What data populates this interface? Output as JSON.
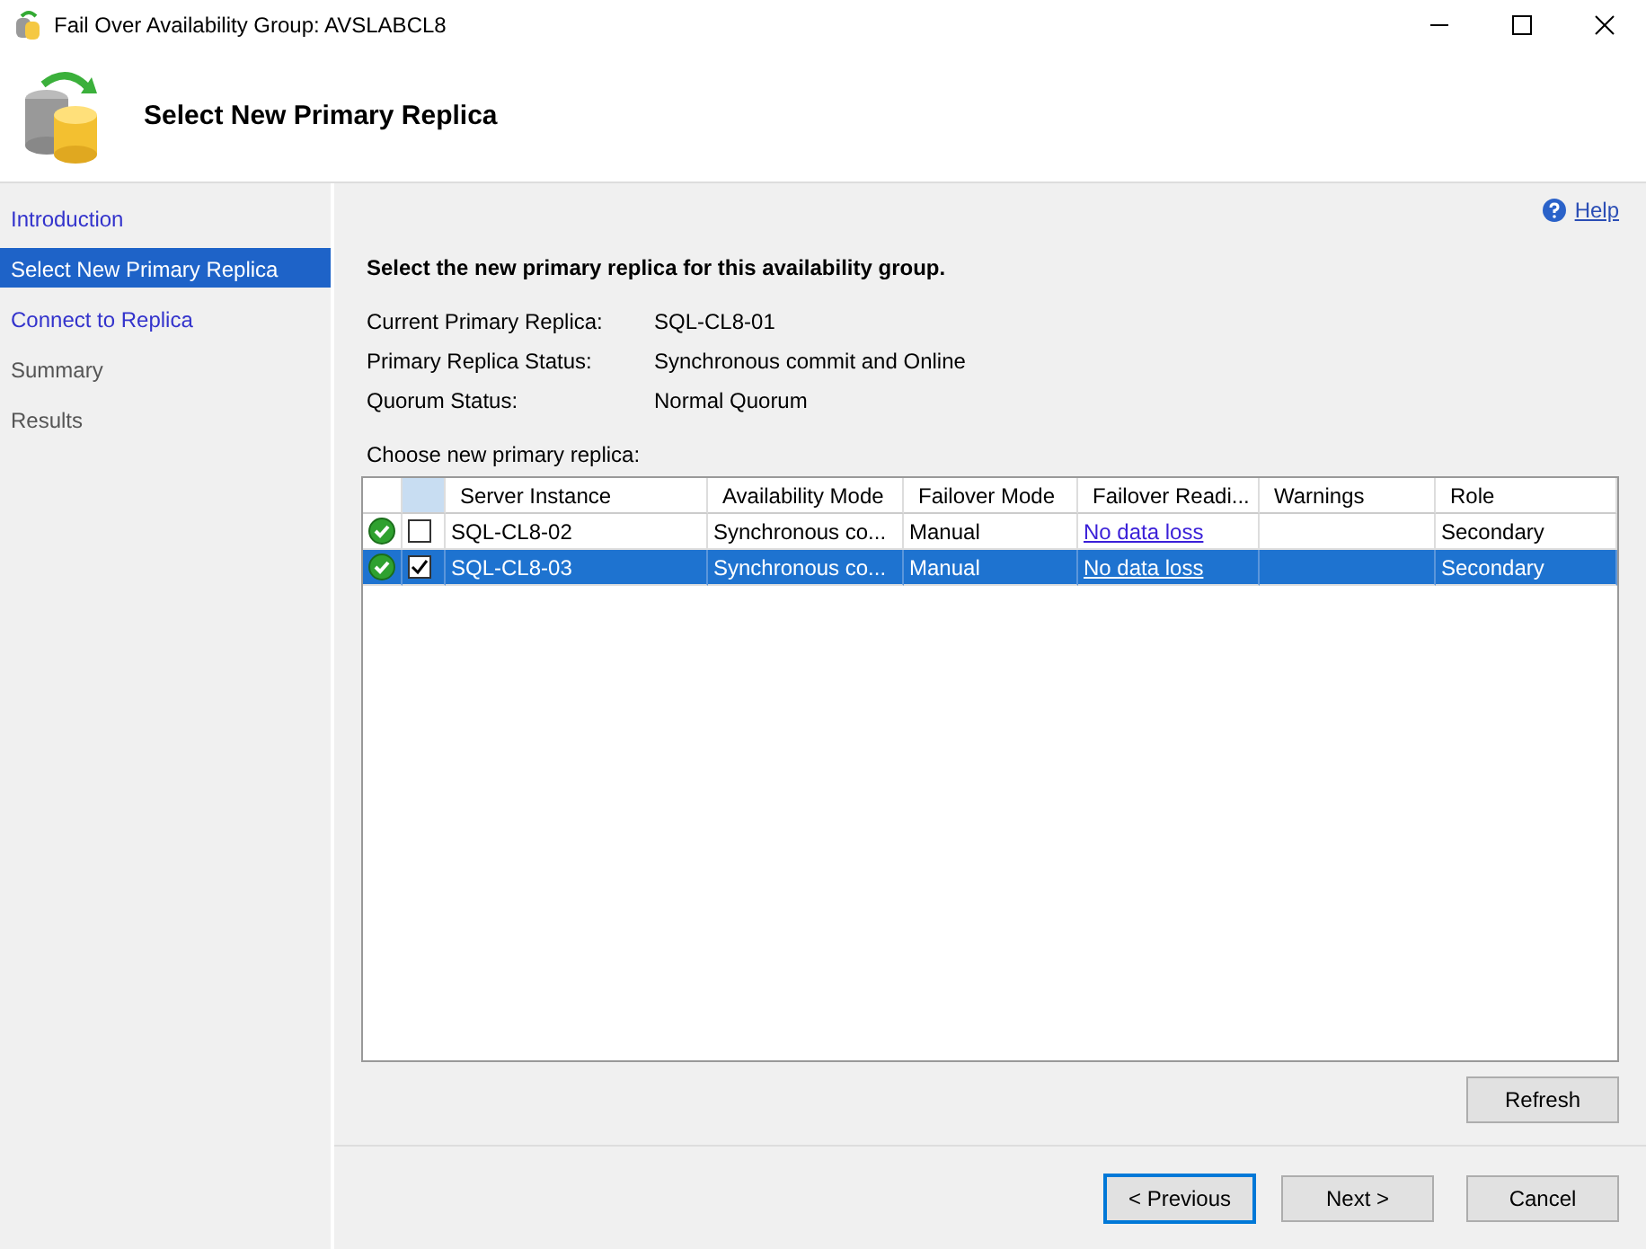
{
  "window": {
    "title": "Fail Over Availability Group: AVSLABCL8"
  },
  "header": {
    "title": "Select New Primary Replica"
  },
  "sidebar": {
    "items": [
      {
        "label": "Introduction",
        "selected": false,
        "enabled": true
      },
      {
        "label": "Select New Primary Replica",
        "selected": true,
        "enabled": true
      },
      {
        "label": "Connect to Replica",
        "selected": false,
        "enabled": true
      },
      {
        "label": "Summary",
        "selected": false,
        "enabled": false
      },
      {
        "label": "Results",
        "selected": false,
        "enabled": false
      }
    ]
  },
  "help": {
    "label": "Help"
  },
  "intro": "Select the new primary replica for this availability group.",
  "info": [
    {
      "label": "Current Primary Replica:",
      "value": "SQL-CL8-01"
    },
    {
      "label": "Primary Replica Status:",
      "value": "Synchronous commit and Online"
    },
    {
      "label": "Quorum Status:",
      "value": "Normal Quorum"
    }
  ],
  "table": {
    "caption": "Choose new primary replica:",
    "columns": [
      "Server Instance",
      "Availability Mode",
      "Failover Mode",
      "Failover Readi...",
      "Warnings",
      "Role"
    ],
    "rows": [
      {
        "ok": true,
        "checked": false,
        "selected": false,
        "cells": [
          "SQL-CL8-02",
          "Synchronous co...",
          "Manual",
          "No data loss",
          "",
          "Secondary"
        ]
      },
      {
        "ok": true,
        "checked": true,
        "selected": true,
        "cells": [
          "SQL-CL8-03",
          "Synchronous co...",
          "Manual",
          "No data loss",
          "",
          "Secondary"
        ]
      }
    ]
  },
  "buttons": {
    "refresh": "Refresh",
    "previous": "< Previous",
    "next": "Next >",
    "cancel": "Cancel"
  }
}
